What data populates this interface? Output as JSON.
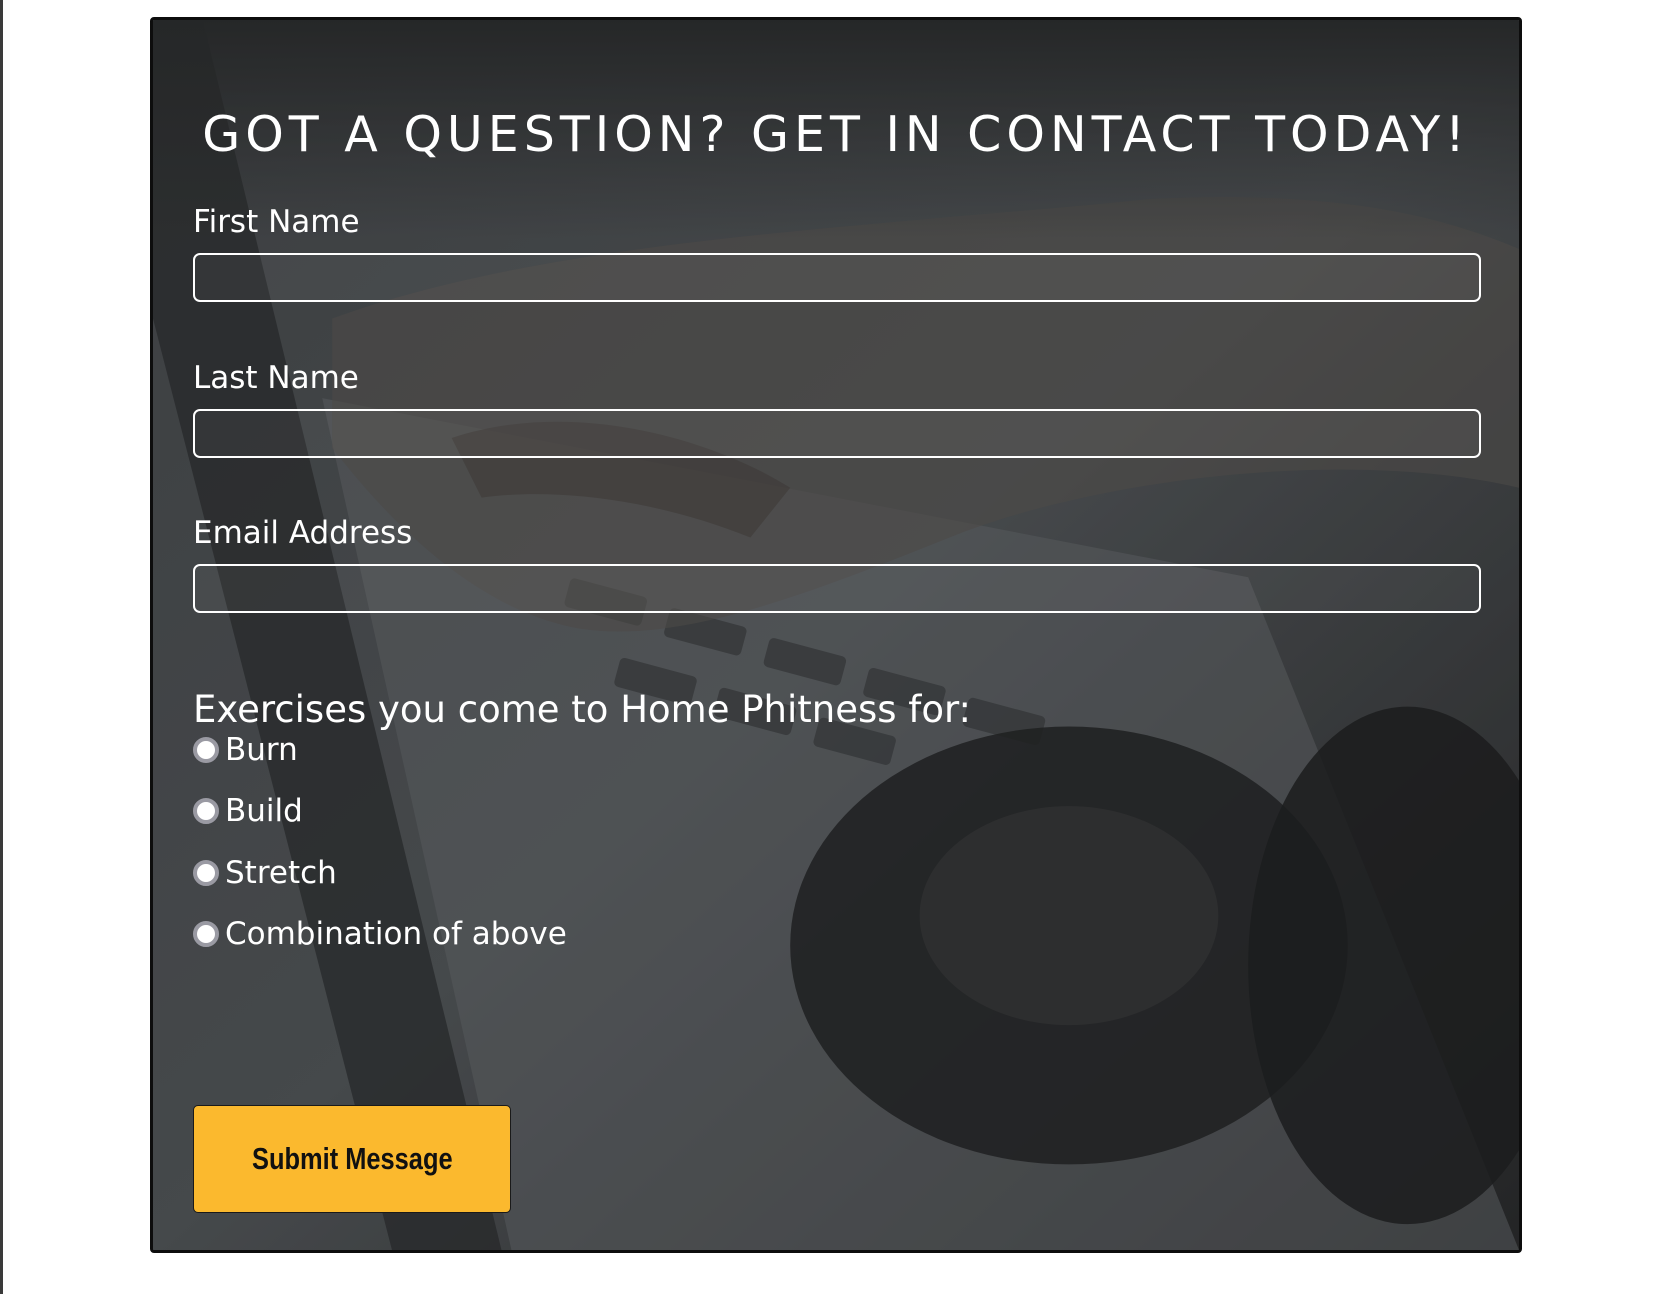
{
  "form": {
    "title": "GOT A QUESTION? GET IN CONTACT TODAY!",
    "fields": [
      {
        "label": "First Name",
        "value": "",
        "placeholder": ""
      },
      {
        "label": "Last Name",
        "value": "",
        "placeholder": ""
      },
      {
        "label": "Email Address",
        "value": "",
        "placeholder": ""
      }
    ],
    "exercises_heading": "Exercises you come to Home Phitness for:",
    "exercise_options": [
      {
        "label": "Burn",
        "selected": false
      },
      {
        "label": "Build",
        "selected": false
      },
      {
        "label": "Stretch",
        "selected": false
      },
      {
        "label": "Combination of above",
        "selected": false
      }
    ],
    "submit_label": "Submit Message"
  },
  "colors": {
    "accent_button": "#fbb92e",
    "text": "#ffffff",
    "card_border": "#0d0d0d"
  },
  "icons": {
    "radio": "radio-button-icon",
    "background": "laptop-typing-hands-headphones-photo"
  }
}
